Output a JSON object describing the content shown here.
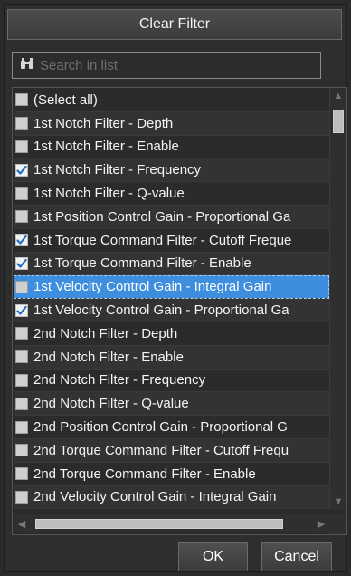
{
  "header": {
    "clear_filter_label": "Clear Filter"
  },
  "search": {
    "placeholder": "Search in list",
    "value": ""
  },
  "list": {
    "items": [
      {
        "label": "(Select all)",
        "checked": false,
        "selected": false
      },
      {
        "label": "1st Notch Filter - Depth",
        "checked": false,
        "selected": false
      },
      {
        "label": "1st Notch Filter - Enable",
        "checked": false,
        "selected": false
      },
      {
        "label": "1st Notch Filter - Frequency",
        "checked": true,
        "selected": false
      },
      {
        "label": "1st Notch Filter - Q-value",
        "checked": false,
        "selected": false
      },
      {
        "label": "1st Position Control Gain - Proportional Ga",
        "checked": false,
        "selected": false
      },
      {
        "label": "1st Torque Command Filter - Cutoff Freque",
        "checked": true,
        "selected": false
      },
      {
        "label": "1st Torque Command Filter - Enable",
        "checked": true,
        "selected": false
      },
      {
        "label": "1st Velocity Control Gain - Integral Gain",
        "checked": false,
        "selected": true
      },
      {
        "label": "1st Velocity Control Gain - Proportional Ga",
        "checked": true,
        "selected": false
      },
      {
        "label": "2nd Notch Filter - Depth",
        "checked": false,
        "selected": false
      },
      {
        "label": "2nd Notch Filter - Enable",
        "checked": false,
        "selected": false
      },
      {
        "label": "2nd Notch Filter - Frequency",
        "checked": false,
        "selected": false
      },
      {
        "label": "2nd Notch Filter - Q-value",
        "checked": false,
        "selected": false
      },
      {
        "label": "2nd Position Control Gain - Proportional G",
        "checked": false,
        "selected": false
      },
      {
        "label": "2nd Torque Command Filter - Cutoff Frequ",
        "checked": false,
        "selected": false
      },
      {
        "label": "2nd Torque Command Filter - Enable",
        "checked": false,
        "selected": false
      },
      {
        "label": "2nd Velocity Control Gain - Integral Gain",
        "checked": false,
        "selected": false
      }
    ]
  },
  "footer": {
    "ok_label": "OK",
    "cancel_label": "Cancel"
  },
  "colors": {
    "selection": "#3d8ede",
    "checkmark": "#1f6fc9"
  }
}
